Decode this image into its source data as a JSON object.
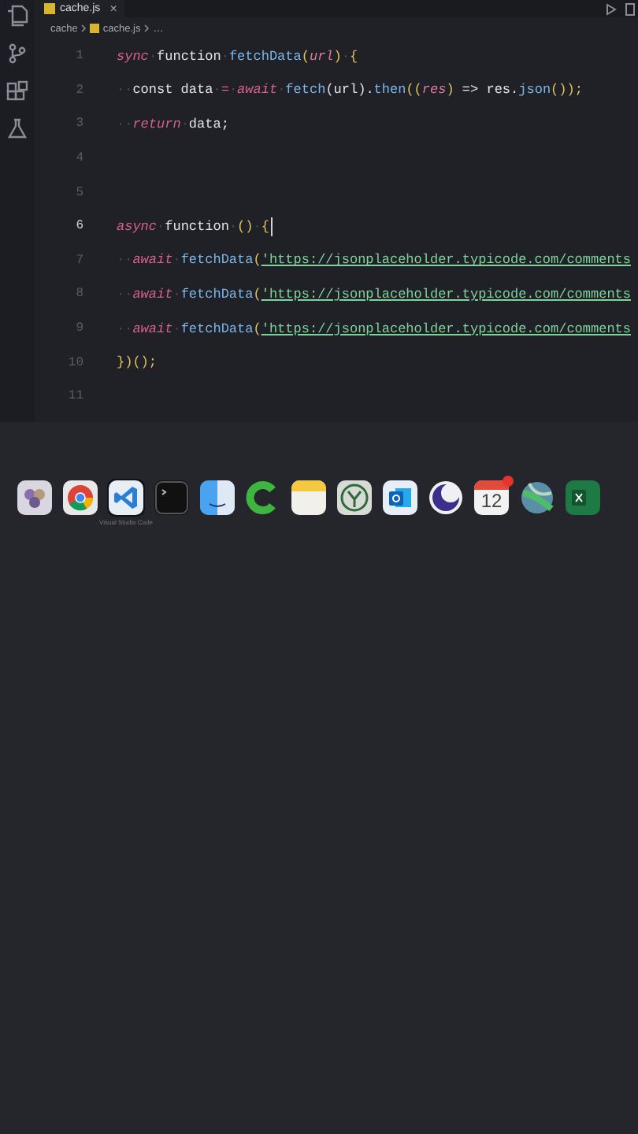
{
  "tab": {
    "label": "cache.js",
    "close": "×"
  },
  "breadcrumbs": [
    "cache",
    "cache.js",
    "…"
  ],
  "code_lines": [
    {
      "number": "1",
      "current": false,
      "tokens": [
        {
          "kind": "keyword",
          "text": "sync"
        },
        {
          "kind": "ws",
          "text": "·"
        },
        {
          "kind": "plain",
          "text": "function"
        },
        {
          "kind": "ws",
          "text": "·"
        },
        {
          "kind": "func",
          "text": "fetchData"
        },
        {
          "kind": "punct",
          "text": "("
        },
        {
          "kind": "param",
          "text": "url"
        },
        {
          "kind": "punct",
          "text": ")"
        },
        {
          "kind": "ws",
          "text": "·"
        },
        {
          "kind": "punct",
          "text": "{"
        }
      ]
    },
    {
      "number": "2",
      "current": false,
      "tokens": [
        {
          "kind": "ws",
          "text": "··"
        },
        {
          "kind": "plain",
          "text": "const data"
        },
        {
          "kind": "ws",
          "text": "·"
        },
        {
          "kind": "keyword",
          "text": "="
        },
        {
          "kind": "ws",
          "text": "·"
        },
        {
          "kind": "keyword",
          "text": "await"
        },
        {
          "kind": "ws",
          "text": "·"
        },
        {
          "kind": "func",
          "text": "fetch"
        },
        {
          "kind": "plain",
          "text": "(url)."
        },
        {
          "kind": "func",
          "text": "then"
        },
        {
          "kind": "punct",
          "text": "(("
        },
        {
          "kind": "param",
          "text": "res"
        },
        {
          "kind": "punct",
          "text": ")"
        },
        {
          "kind": "plain",
          "text": " => res."
        },
        {
          "kind": "func",
          "text": "json"
        },
        {
          "kind": "punct",
          "text": "());"
        }
      ]
    },
    {
      "number": "3",
      "current": false,
      "tokens": [
        {
          "kind": "ws",
          "text": "··"
        },
        {
          "kind": "keyword",
          "text": "return"
        },
        {
          "kind": "ws",
          "text": "·"
        },
        {
          "kind": "plain",
          "text": "data;"
        }
      ]
    },
    {
      "number": "4",
      "current": false
    },
    {
      "number": "5",
      "current": false
    },
    {
      "number": "6",
      "current": true,
      "tokens": [
        {
          "kind": "keyword",
          "text": "async"
        },
        {
          "kind": "ws",
          "text": "·"
        },
        {
          "kind": "plain",
          "text": "function"
        },
        {
          "kind": "ws",
          "text": "·"
        },
        {
          "kind": "punct",
          "text": "()"
        },
        {
          "kind": "ws",
          "text": "·"
        },
        {
          "kind": "punct",
          "text": "{"
        }
      ]
    },
    {
      "number": "7",
      "current": false,
      "tokens": [
        {
          "kind": "ws",
          "text": "··"
        },
        {
          "kind": "keyword",
          "text": "await"
        },
        {
          "kind": "ws",
          "text": "·"
        },
        {
          "kind": "func",
          "text": "fetchData"
        },
        {
          "kind": "punct",
          "text": "("
        },
        {
          "kind": "string",
          "text": "'https://jsonplaceholder.typicode.com/comments"
        }
      ]
    },
    {
      "number": "8",
      "current": false,
      "tokens": [
        {
          "kind": "ws",
          "text": "··"
        },
        {
          "kind": "keyword",
          "text": "await"
        },
        {
          "kind": "ws",
          "text": "·"
        },
        {
          "kind": "func",
          "text": "fetchData"
        },
        {
          "kind": "punct",
          "text": "("
        },
        {
          "kind": "string",
          "text": "'https://jsonplaceholder.typicode.com/comments"
        }
      ]
    },
    {
      "number": "9",
      "current": false,
      "tokens": [
        {
          "kind": "ws",
          "text": "··"
        },
        {
          "kind": "keyword",
          "text": "await"
        },
        {
          "kind": "ws",
          "text": "·"
        },
        {
          "kind": "func",
          "text": "fetchData"
        },
        {
          "kind": "punct",
          "text": "("
        },
        {
          "kind": "string",
          "text": "'https://jsonplaceholder.typicode.com/comments"
        }
      ]
    },
    {
      "number": "10",
      "current": false,
      "tokens": [
        {
          "kind": "punct",
          "text": "})();"
        }
      ]
    },
    {
      "number": "11",
      "current": false
    }
  ],
  "dock": [
    {
      "kind": "photos",
      "active": false
    },
    {
      "kind": "chrome",
      "active": false
    },
    {
      "kind": "vscode",
      "active": true,
      "tooltip": "Visual Studio Code"
    },
    {
      "kind": "terminal",
      "active": false
    },
    {
      "kind": "finder",
      "active": false
    },
    {
      "kind": "cleaner",
      "active": false
    },
    {
      "kind": "notes",
      "active": false
    },
    {
      "kind": "vpn",
      "active": false
    },
    {
      "kind": "outlook",
      "active": false
    },
    {
      "kind": "moon",
      "active": false
    },
    {
      "kind": "calendar",
      "active": false,
      "label": "12"
    },
    {
      "kind": "maps",
      "active": false
    },
    {
      "kind": "excel",
      "active": false
    }
  ]
}
